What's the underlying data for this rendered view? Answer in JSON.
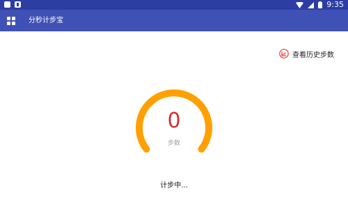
{
  "status_bar": {
    "time": "9:35",
    "icons": [
      "notification-square-icon",
      "sim-card-icon",
      "wifi-icon",
      "signal-icon",
      "battery-icon"
    ]
  },
  "app_bar": {
    "title": "分秒计步宝",
    "menu_icon": "grid-apps-icon",
    "background": "#3f51b5",
    "status_background": "#2c3ea3"
  },
  "history": {
    "label": "查看历史步数",
    "icon": "chart-history-icon",
    "icon_color": "#e53935"
  },
  "counter": {
    "value": "0",
    "unit": "步数",
    "value_color": "#d32f2f",
    "ring_color": "#ffa000"
  },
  "footer": {
    "status": "计步中..."
  }
}
